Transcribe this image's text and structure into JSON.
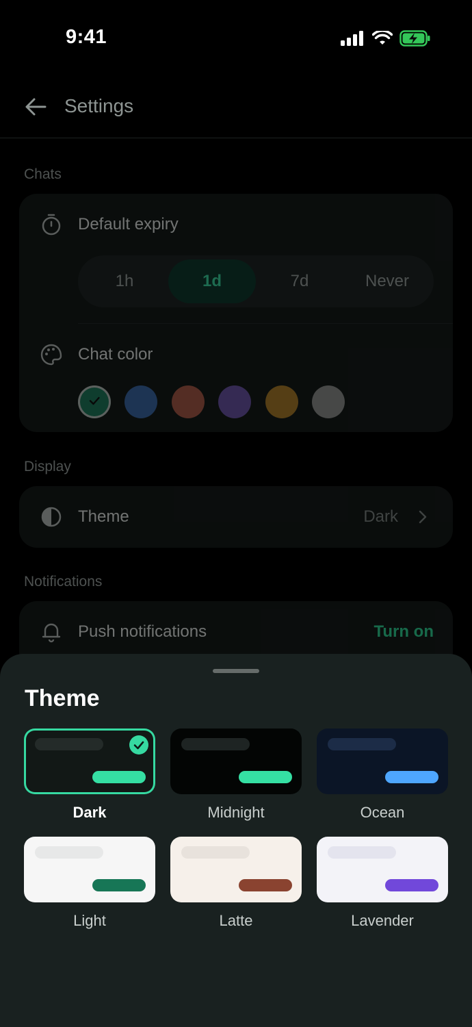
{
  "status_bar": {
    "time": "9:41"
  },
  "header": {
    "title": "Settings"
  },
  "sections": {
    "chats": {
      "label": "Chats",
      "expiry": {
        "label": "Default expiry",
        "options": [
          "1h",
          "1d",
          "7d",
          "Never"
        ],
        "selected": "1d"
      },
      "chat_color": {
        "label": "Chat color",
        "colors": [
          "#1f7a5c",
          "#3b69a6",
          "#a85a48",
          "#6b55a5",
          "#a97d2a",
          "#8d8f8e"
        ],
        "selected_index": 0
      }
    },
    "display": {
      "label": "Display",
      "theme_row": {
        "label": "Theme",
        "value": "Dark"
      }
    },
    "notifications": {
      "label": "Notifications",
      "push": {
        "label": "Push notifications",
        "action": "Turn on"
      }
    }
  },
  "sheet": {
    "title": "Theme",
    "themes": [
      {
        "name": "Dark",
        "bg": "#121816",
        "bar_a": "#242b29",
        "bar_b": "#35dfa3",
        "selected": true
      },
      {
        "name": "Midnight",
        "bg": "#030504",
        "bar_a": "#1e2423",
        "bar_b": "#35dfa3",
        "selected": false
      },
      {
        "name": "Ocean",
        "bg": "#0b1526",
        "bar_a": "#1c2c47",
        "bar_b": "#4ea6ff",
        "selected": false
      },
      {
        "name": "Light",
        "bg": "#f6f6f6",
        "bar_a": "#e7e8e8",
        "bar_b": "#177656",
        "selected": false
      },
      {
        "name": "Latte",
        "bg": "#f6f0ea",
        "bar_a": "#e8e2dc",
        "bar_b": "#8a4330",
        "selected": false
      },
      {
        "name": "Lavender",
        "bg": "#f3f3f8",
        "bar_a": "#e4e4ee",
        "bar_b": "#7148da",
        "selected": false
      }
    ]
  }
}
